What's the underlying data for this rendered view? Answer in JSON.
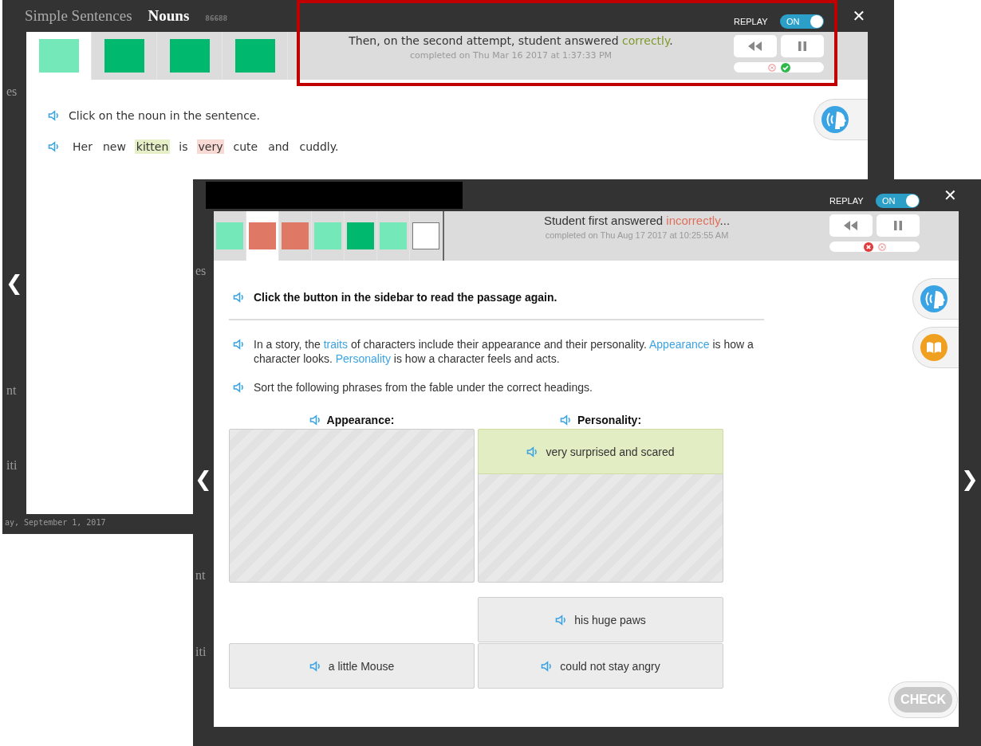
{
  "background_texts": [
    "es",
    "nt",
    "iti",
    "es",
    "nt",
    "iti",
    "ay, September 1, 2017"
  ],
  "back_window": {
    "highlighted": true,
    "redacted": false,
    "title": "Simple Sentences",
    "subtitle": "Nouns",
    "code": "86688",
    "replay": {
      "label": "REPLAY",
      "toggle_text": "ON",
      "on": true
    },
    "close": "✕",
    "nav": {
      "previous": "❮"
    },
    "progress": [
      {
        "color": "#74e8b8",
        "selected": true
      },
      {
        "color": "#00b96f",
        "selected": false
      },
      {
        "color": "#00b96f",
        "selected": false
      },
      {
        "color": "#00b96f",
        "selected": false
      }
    ],
    "feedback": {
      "before": "Then, on the second attempt, student answered ",
      "result_word": "correctly",
      "after": ".",
      "correct": true,
      "timestamp": "completed on Thu Mar 16 2017 at 1:37:33 PM"
    },
    "attempts": [
      {
        "kind": "cross",
        "selected": false
      },
      {
        "kind": "check",
        "selected": true
      }
    ],
    "sidebar": [
      {
        "kind": "audio"
      }
    ],
    "content": {
      "instruction": "Click on the noun in the sentence.",
      "sentence": [
        {
          "text": "Her"
        },
        {
          "text": "new"
        },
        {
          "text": "kitten",
          "color": "#e4efc6"
        },
        {
          "text": "is"
        },
        {
          "text": "very",
          "color": "#f9d9d4"
        },
        {
          "text": "cute"
        },
        {
          "text": "and"
        },
        {
          "text": "cuddly."
        }
      ]
    }
  },
  "front_window": {
    "highlighted": false,
    "redacted": true,
    "replay": {
      "label": "REPLAY",
      "toggle_text": "ON",
      "on": true
    },
    "close": "✕",
    "nav": {
      "previous": "❮",
      "next": "❯"
    },
    "progress": [
      {
        "color": "#74e8b8",
        "selected": false
      },
      {
        "color": "#e07866",
        "selected": true
      },
      {
        "color": "#e07866",
        "selected": false
      },
      {
        "color": "#74e8b8",
        "selected": false
      },
      {
        "color": "#00b96f",
        "selected": false
      },
      {
        "color": "#74e8b8",
        "selected": false
      },
      {
        "color": "#ffffff",
        "selected": false
      }
    ],
    "feedback": {
      "before": "Student first answered ",
      "result_word": "incorrectly",
      "after": "...",
      "correct": false,
      "timestamp": "completed on Thu Aug 17 2017 at 10:25:55 AM"
    },
    "attempts": [
      {
        "kind": "cross",
        "selected": true
      },
      {
        "kind": "cross",
        "selected": false
      }
    ],
    "sidebar": [
      {
        "kind": "audio"
      },
      {
        "kind": "book"
      }
    ],
    "content": {
      "instruction": "Click the button in the sidebar to read the passage again.",
      "passage": [
        {
          "text": "In a story, the "
        },
        {
          "text": "traits",
          "term": true
        },
        {
          "text": " of characters include their appearance and their personality. "
        },
        {
          "text": "Appearance",
          "term": true
        },
        {
          "text": " is how a character looks. "
        },
        {
          "text": "Personality",
          "term": true
        },
        {
          "text": " is how a character feels and acts."
        }
      ],
      "prompt": "Sort the following phrases from the fable under the correct headings.",
      "columns": [
        {
          "heading": "Appearance:"
        },
        {
          "heading": "Personality:",
          "items": [
            {
              "text": "very surprised and scared",
              "highlighted": true
            }
          ]
        }
      ],
      "bank": [
        [
          {
            "text": "a little Mouse"
          }
        ],
        [
          {
            "text": "his huge paws"
          },
          {
            "text": "could not stay angry"
          }
        ]
      ],
      "check_button": {
        "label": "CHECK",
        "disabled": true
      }
    }
  }
}
